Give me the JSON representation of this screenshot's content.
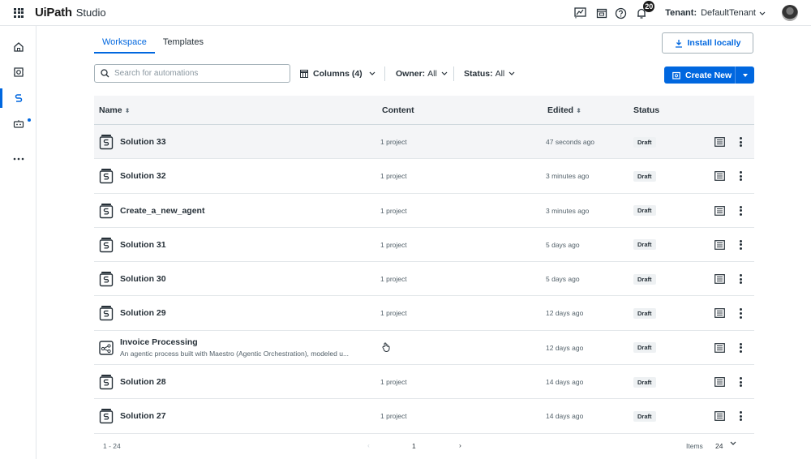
{
  "header": {
    "brand_logo": "UiPath",
    "brand_product": "Studio",
    "notification_count": "20",
    "tenant_label": "Tenant:",
    "tenant_value": "DefaultTenant"
  },
  "tabs": [
    {
      "label": "Workspace",
      "active": true
    },
    {
      "label": "Templates",
      "active": false
    }
  ],
  "install_button": "Install locally",
  "search": {
    "placeholder": "Search for automations",
    "value": ""
  },
  "filters": {
    "columns": "Columns (4)",
    "owner_label": "Owner:",
    "owner_value": "All",
    "status_label": "Status:",
    "status_value": "All"
  },
  "create_button": "Create New",
  "table": {
    "columns": [
      "Name",
      "Content",
      "Edited",
      "Status"
    ],
    "rows": [
      {
        "name": "Solution 33",
        "subtitle": "",
        "content": "1 project",
        "edited": "47 seconds ago",
        "status": "Draft",
        "icon": "solution-icon"
      },
      {
        "name": "Solution 32",
        "subtitle": "",
        "content": "1 project",
        "edited": "3 minutes ago",
        "status": "Draft",
        "icon": "solution-icon"
      },
      {
        "name": "Create_a_new_agent",
        "subtitle": "",
        "content": "1 project",
        "edited": "3 minutes ago",
        "status": "Draft",
        "icon": "solution-icon"
      },
      {
        "name": "Solution 31",
        "subtitle": "",
        "content": "1 project",
        "edited": "5 days ago",
        "status": "Draft",
        "icon": "solution-icon"
      },
      {
        "name": "Solution 30",
        "subtitle": "",
        "content": "1 project",
        "edited": "5 days ago",
        "status": "Draft",
        "icon": "solution-icon"
      },
      {
        "name": "Solution 29",
        "subtitle": "",
        "content": "1 project",
        "edited": "12 days ago",
        "status": "Draft",
        "icon": "solution-icon"
      },
      {
        "name": "Invoice Processing",
        "subtitle": "An agentic process built with Maestro (Agentic Orchestration), modeled u...",
        "content": "",
        "edited": "12 days ago",
        "status": "Draft",
        "icon": "process-icon"
      },
      {
        "name": "Solution 28",
        "subtitle": "",
        "content": "1 project",
        "edited": "14 days ago",
        "status": "Draft",
        "icon": "solution-icon"
      },
      {
        "name": "Solution 27",
        "subtitle": "",
        "content": "1 project",
        "edited": "14 days ago",
        "status": "Draft",
        "icon": "solution-icon"
      }
    ]
  },
  "footer": {
    "range": "1 - 24",
    "page": "1",
    "items_label": "Items",
    "items_value": "24"
  },
  "colors": {
    "accent": "#0067df",
    "text": "#273139",
    "border": "#e3e7ea"
  }
}
